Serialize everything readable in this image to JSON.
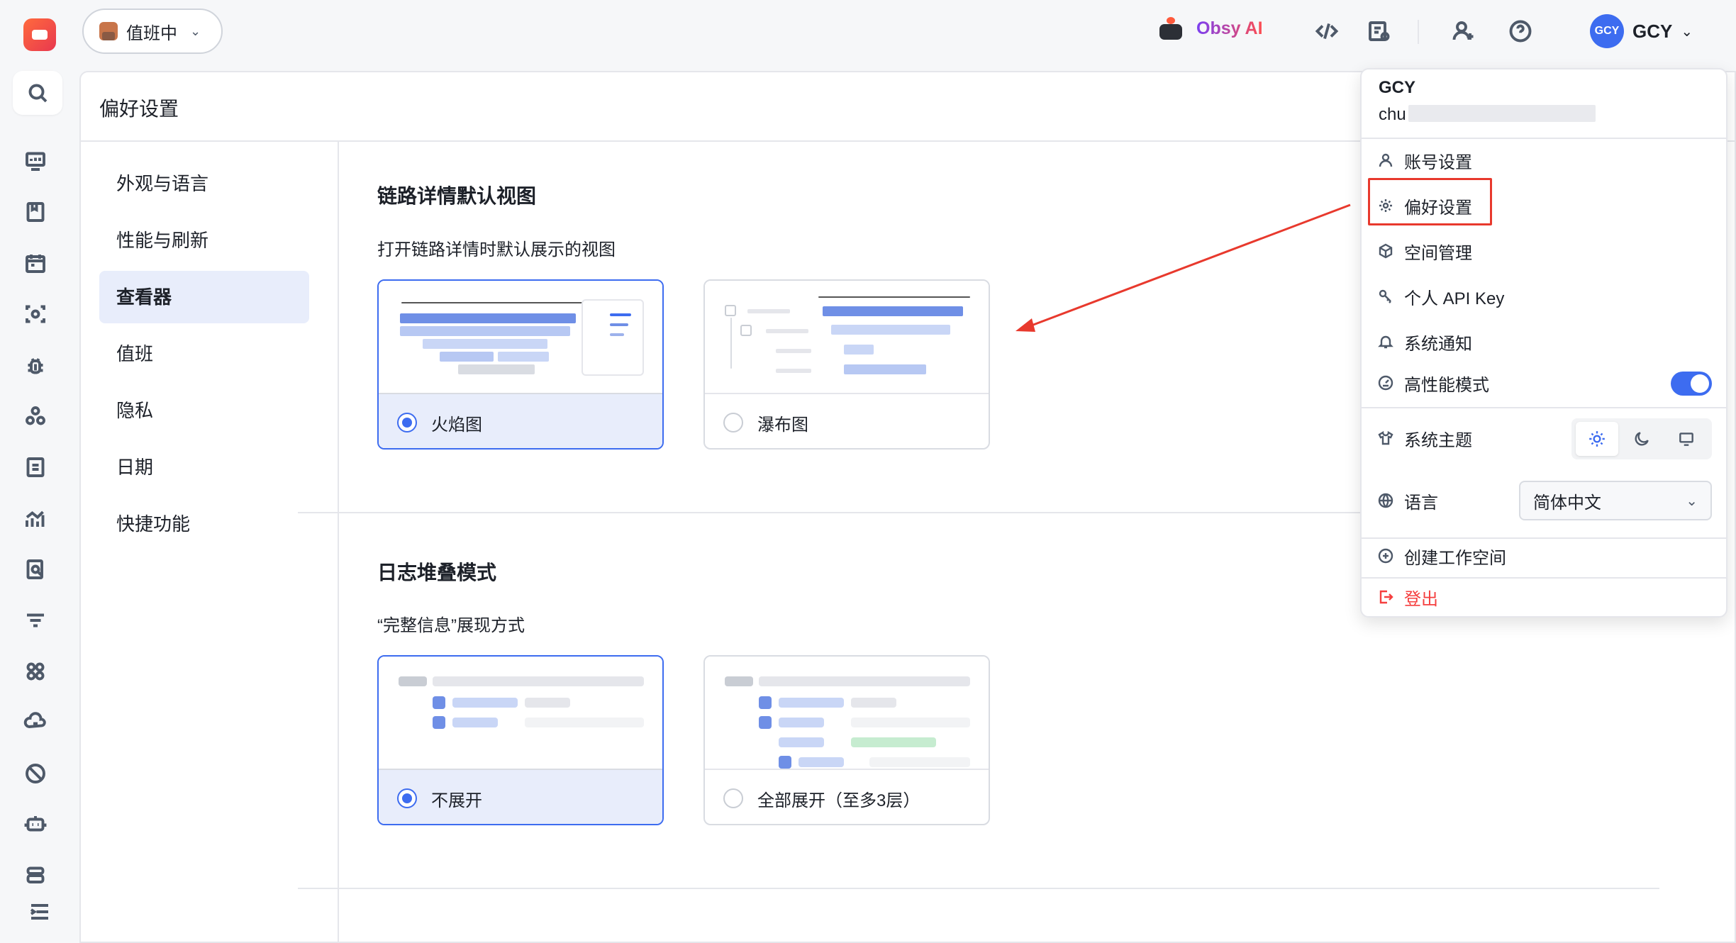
{
  "topbar": {
    "duty_label": "值班中",
    "ai_label": "Obsy AI",
    "user_initials": "GCY",
    "user_name": "GCY"
  },
  "rail_icons": [
    "logo-icon",
    "search-icon",
    "dashboard-icon",
    "notebook-icon",
    "calendar-icon",
    "scan-icon",
    "bug-icon",
    "services-icon",
    "document-icon",
    "metrics-icon",
    "log-search-icon",
    "filter-icon",
    "apps-icon",
    "cloud-icon",
    "disable-icon",
    "robot-icon",
    "database-icon",
    "collapse-menu-icon"
  ],
  "page": {
    "title": "偏好设置",
    "nav": [
      {
        "label": "外观与语言",
        "active": false
      },
      {
        "label": "性能与刷新",
        "active": false
      },
      {
        "label": "查看器",
        "active": true
      },
      {
        "label": "值班",
        "active": false
      },
      {
        "label": "隐私",
        "active": false
      },
      {
        "label": "日期",
        "active": false
      },
      {
        "label": "快捷功能",
        "active": false
      }
    ]
  },
  "sections": {
    "trace_view": {
      "title": "链路详情默认视图",
      "desc": "打开链路详情时默认展示的视图",
      "options": [
        {
          "label": "火焰图",
          "selected": true
        },
        {
          "label": "瀑布图",
          "selected": false
        }
      ]
    },
    "log_stack": {
      "title": "日志堆叠模式",
      "desc": "“完整信息”展现方式",
      "options": [
        {
          "label": "不展开",
          "selected": true
        },
        {
          "label": "全部展开（至多3层）",
          "selected": false
        }
      ]
    }
  },
  "user_menu": {
    "name": "GCY",
    "email_prefix": "chu",
    "items": {
      "account": "账号设置",
      "preferences": "偏好设置",
      "space": "空间管理",
      "api_key": "个人 API Key",
      "notifications": "系统通知",
      "high_perf": "高性能模式",
      "theme": "系统主题",
      "language": "语言",
      "create_space": "创建工作空间",
      "logout": "登出"
    },
    "high_perf_on": true,
    "theme_selected": "light",
    "language_value": "简体中文"
  },
  "colors": {
    "accent": "#3d6cf0",
    "annotation": "#e8392d",
    "danger": "#f53f3f"
  }
}
